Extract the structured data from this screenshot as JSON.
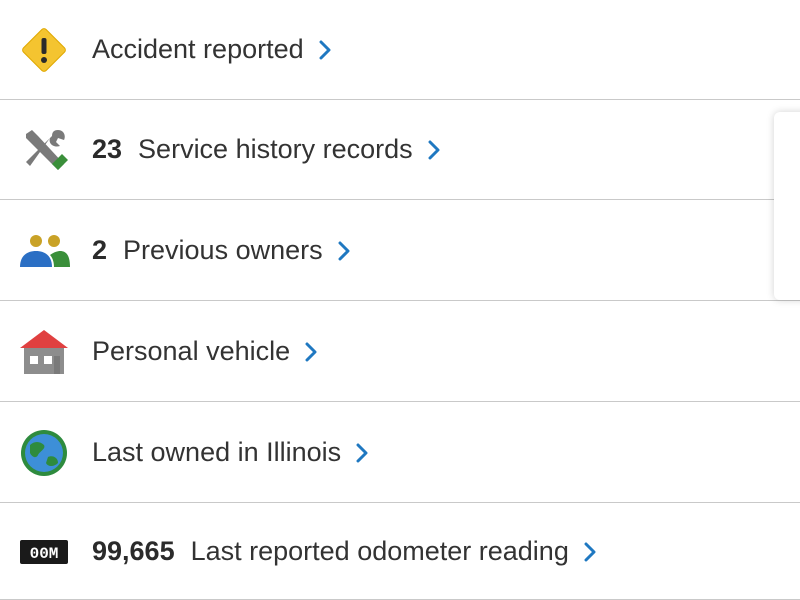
{
  "items": [
    {
      "count": "",
      "label": "Accident reported",
      "icon": "warning-icon"
    },
    {
      "count": "23",
      "label": "Service history records",
      "icon": "tools-icon"
    },
    {
      "count": "2",
      "label": "Previous owners",
      "icon": "owners-icon"
    },
    {
      "count": "",
      "label": "Personal vehicle",
      "icon": "house-icon"
    },
    {
      "count": "",
      "label": "Last owned in Illinois",
      "icon": "globe-icon"
    },
    {
      "count": "99,665",
      "label": "Last reported odometer reading",
      "icon": "odometer-icon"
    }
  ],
  "odometer_icon_text": "00M",
  "colors": {
    "chevron": "#1f78c1",
    "divider": "#c9c9c9",
    "warning": "#f4c430",
    "wrench": "#7a7a7a",
    "wrench_handle": "#3a8f3a",
    "owner_a": "#2b6fc4",
    "owner_b": "#3a8f3a",
    "owner_heads": "#c9a227",
    "roof": "#e04040",
    "house": "#8d8d8d",
    "globe_ocean": "#3d8fd8",
    "globe_land": "#2e8b3e"
  }
}
